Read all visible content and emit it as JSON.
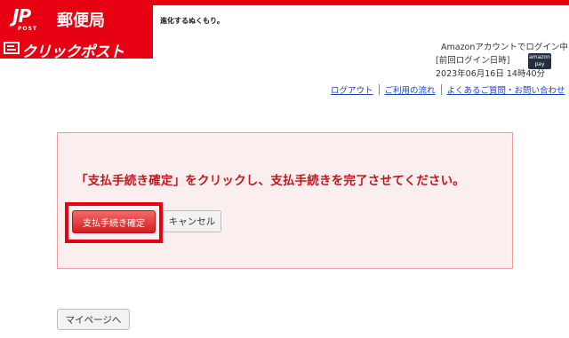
{
  "brand": {
    "jp_mark": "JP",
    "post_label": "POST",
    "yubin": "郵便局",
    "service_name": "クリックポスト",
    "tagline": "進化するぬくもり。"
  },
  "login": {
    "status": "Amazonアカウントでログイン中",
    "last_login_label": "[前回ログイン日時]",
    "last_login_value": "2023年06月16日 14時40分",
    "badge_line1": "amazon",
    "badge_line2": "pay"
  },
  "nav": {
    "logout": "ログアウト",
    "flow": "ご利用の流れ",
    "faq": "よくあるご質問・お問い合わせ"
  },
  "notice": {
    "message": "「支払手続き確定」をクリックし、支払手続きを完了させてください。",
    "confirm_label": "支払手続き確定",
    "cancel_label": "キャンセル"
  },
  "footer": {
    "mypage_label": "マイページへ"
  },
  "colors": {
    "brand_red": "#e60012",
    "message_red": "#c4161c",
    "link_blue": "#1a44c2",
    "notice_bg": "#fbeeee"
  }
}
